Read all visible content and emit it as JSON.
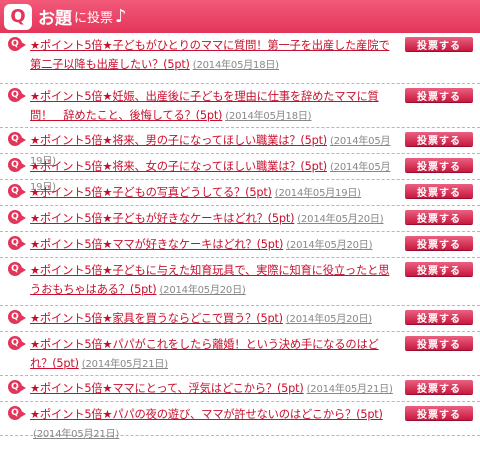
{
  "header": {
    "badge": "Q",
    "title": "お題",
    "subtitle": "に投票",
    "note": "♪"
  },
  "bullet_icon": "q-arrow-icon",
  "accent": "#e3355a",
  "vote_label": "投票する",
  "questions": [
    {
      "text": "★ポイント5倍★子どもがひとりのママに質問！第一子を出産した産院で第二子以降も出産したい？(5pt)",
      "date": "(2014年05月18日)"
    },
    {
      "text": "★ポイント5倍★妊娠、出産後に子どもを理由に仕事を辞めたママに質問！　辞めたこと、後悔してる？(5pt)",
      "date": "(2014年05月18日)"
    },
    {
      "text": "★ポイント5倍★将来、男の子になってほしい職業は？(5pt)",
      "date": "(2014年05月19日)"
    },
    {
      "text": "★ポイント5倍★将来、女の子になってほしい職業は？(5pt)",
      "date": "(2014年05月19日)"
    },
    {
      "text": "★ポイント5倍★子どもの写真どうしてる？(5pt)",
      "date": "(2014年05月19日)"
    },
    {
      "text": "★ポイント5倍★子どもが好きなケーキはどれ？(5pt)",
      "date": "(2014年05月20日)"
    },
    {
      "text": "★ポイント5倍★ママが好きなケーキはどれ？(5pt)",
      "date": "(2014年05月20日)"
    },
    {
      "text": "★ポイント5倍★子どもに与えた知育玩具で、実際に知育に役立ったと思うおもちゃはある？(5pt)",
      "date": "(2014年05月20日)"
    },
    {
      "text": "★ポイント5倍★家具を買うならどこで買う？(5pt)",
      "date": "(2014年05月20日)"
    },
    {
      "text": "★ポイント5倍★パパがこれをしたら離婚！という決め手になるのはどれ？(5pt)",
      "date": "(2014年05月21日)"
    },
    {
      "text": "★ポイント5倍★ママにとって、浮気はどこから？(5pt)",
      "date": "(2014年05月21日)"
    },
    {
      "text": "★ポイント5倍★パパの夜の遊び、ママが許せないのはどこから？(5pt)",
      "date": "(2014年05月21日)"
    }
  ]
}
